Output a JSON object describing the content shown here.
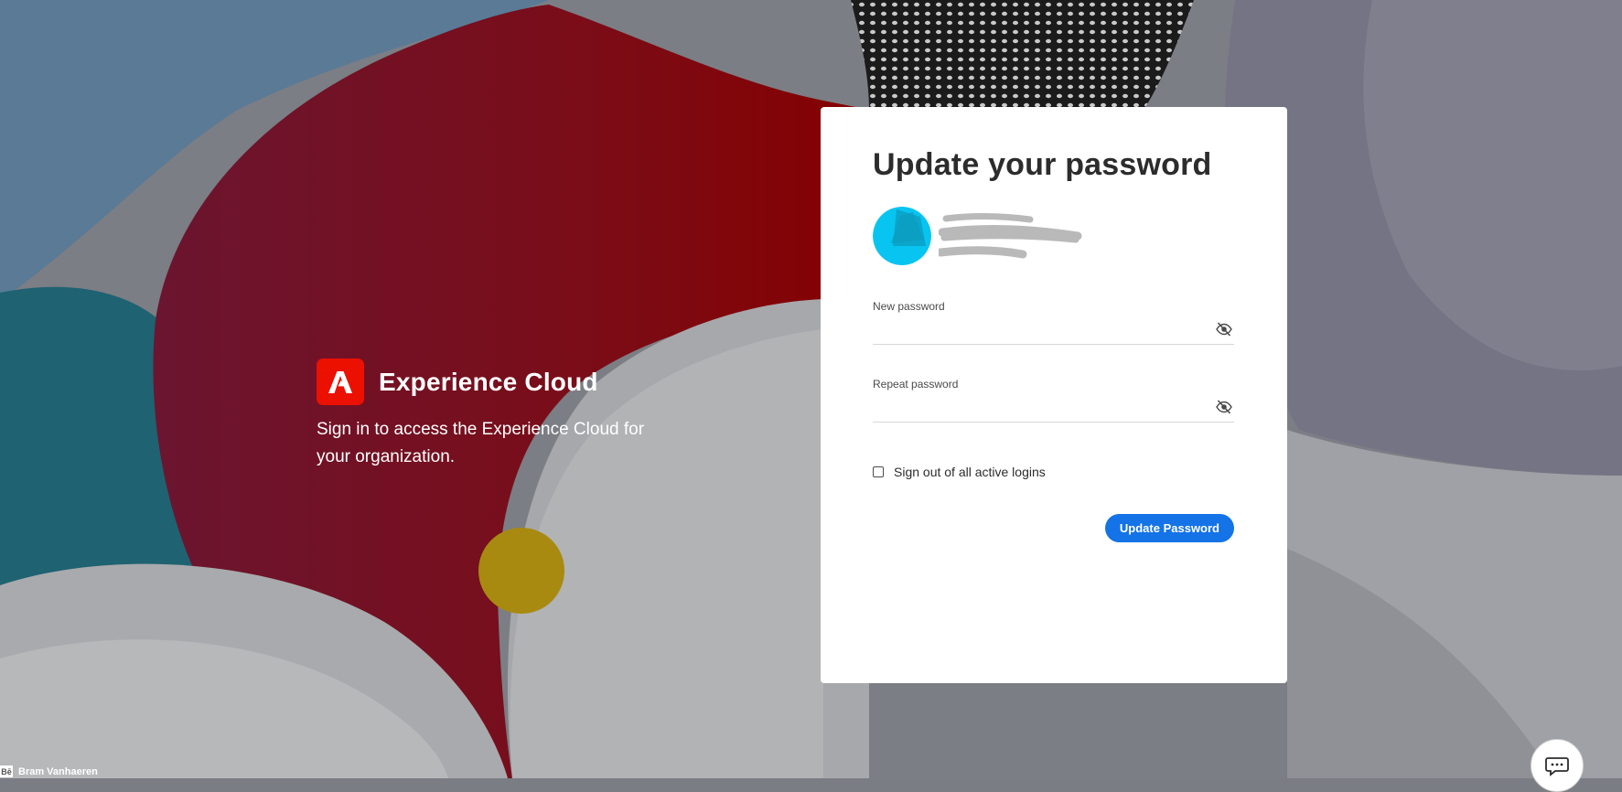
{
  "brand": {
    "name": "Experience Cloud",
    "tagline": "Sign in to access the Experience Cloud for your organization.",
    "logo_color": "#eb1000"
  },
  "card": {
    "title": "Update your password",
    "new_password": {
      "label": "New password",
      "value": ""
    },
    "repeat_password": {
      "label": "Repeat password",
      "value": ""
    },
    "checkbox_label": "Sign out of all active logins",
    "checkbox_checked": false,
    "submit_label": "Update Password",
    "accent_color": "#1473e6"
  },
  "footer": {
    "credit_badge": "Bē",
    "credit_name": "Bram Vanhaeren"
  },
  "icons": {
    "password_toggle": "eye-off-icon",
    "help_chat": "chat-icon"
  }
}
